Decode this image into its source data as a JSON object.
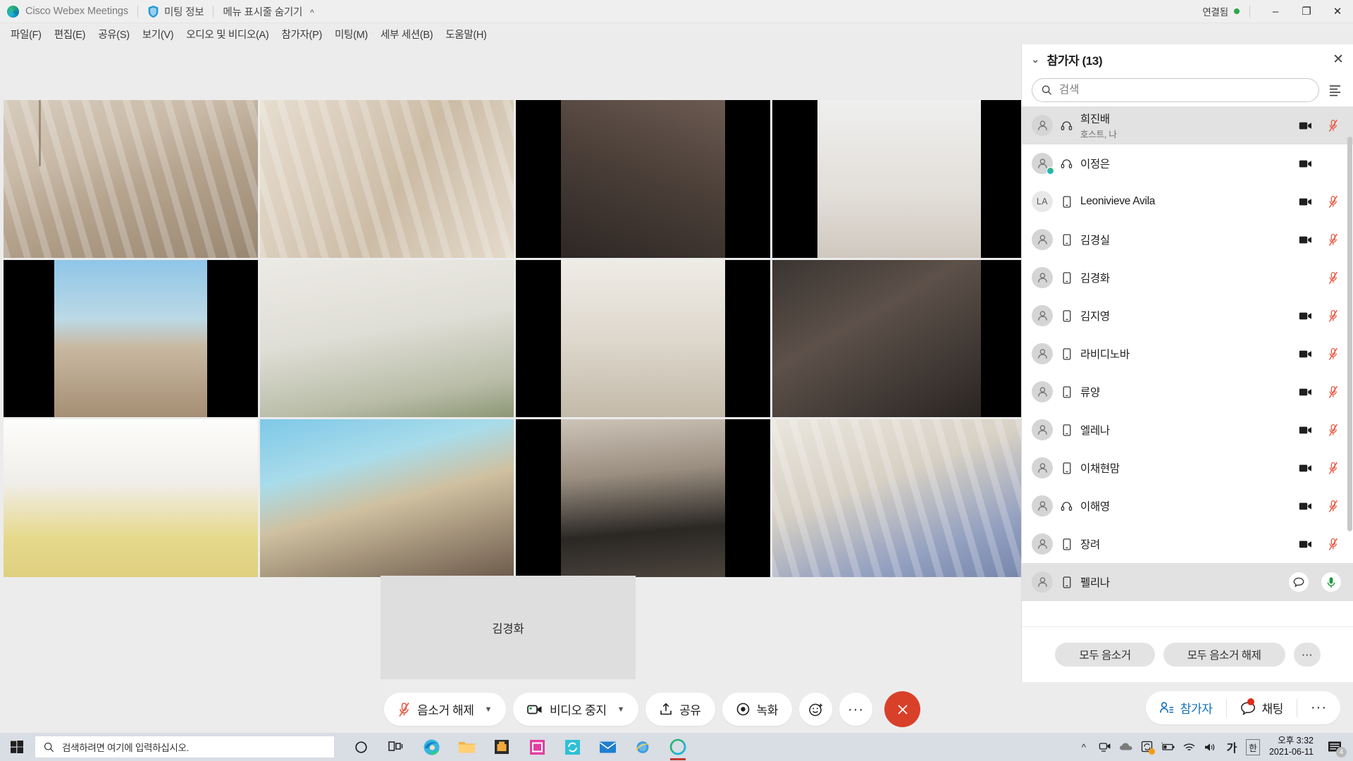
{
  "titlebar": {
    "app_name": "Cisco Webex Meetings",
    "meeting_info": "미팅 정보",
    "hide_menubar": "메뉴 표시줄 숨기기",
    "connection_status": "연결됨",
    "minimize": "–",
    "maximize": "❐",
    "close": "✕"
  },
  "menubar": {
    "items": [
      {
        "label": "파일(F)"
      },
      {
        "label": "편집(E)"
      },
      {
        "label": "공유(S)"
      },
      {
        "label": "보기(V)"
      },
      {
        "label": "오디오 및 비디오(A)"
      },
      {
        "label": "참가자(P)"
      },
      {
        "label": "미팅(M)"
      },
      {
        "label": "세부 세션(B)"
      },
      {
        "label": "도움말(H)"
      }
    ]
  },
  "stage": {
    "active_speaker_name": "김경화"
  },
  "controlbar": {
    "mute_label": "음소거 해제",
    "video_label": "비디오 중지",
    "share_label": "공유",
    "record_label": "녹화",
    "reactions_label": "리액션",
    "more_label": "···",
    "end_label": "✕",
    "participants_label": "참가자",
    "chat_label": "채팅",
    "right_more_label": "···"
  },
  "panel": {
    "title": "참가자 (13)",
    "close": "✕",
    "search_placeholder": "검색",
    "search_value": "",
    "mute_all": "모두 음소거",
    "unmute_all": "모두 음소거 해제",
    "more": "···",
    "participants": [
      {
        "name": "희진배",
        "sub": "호스트, 나",
        "avatar": "person",
        "initials": "",
        "device": "headset",
        "video": true,
        "mic": "muted",
        "selected": true,
        "presence": false
      },
      {
        "name": "이정은",
        "sub": "",
        "avatar": "person",
        "initials": "",
        "device": "headset",
        "video": true,
        "mic": "none",
        "selected": false,
        "presence": true
      },
      {
        "name": "Leonivieve Avila",
        "sub": "",
        "avatar": "initials",
        "initials": "LA",
        "device": "phone",
        "video": true,
        "mic": "muted",
        "selected": false,
        "presence": false
      },
      {
        "name": "김경실",
        "sub": "",
        "avatar": "person",
        "initials": "",
        "device": "phone",
        "video": true,
        "mic": "muted",
        "selected": false,
        "presence": false
      },
      {
        "name": "김경화",
        "sub": "",
        "avatar": "person",
        "initials": "",
        "device": "phone",
        "video": false,
        "mic": "muted",
        "selected": false,
        "presence": false
      },
      {
        "name": "김지영",
        "sub": "",
        "avatar": "person",
        "initials": "",
        "device": "phone",
        "video": true,
        "mic": "muted",
        "selected": false,
        "presence": false
      },
      {
        "name": "라비디노바",
        "sub": "",
        "avatar": "person",
        "initials": "",
        "device": "phone",
        "video": true,
        "mic": "muted",
        "selected": false,
        "presence": false
      },
      {
        "name": "류양",
        "sub": "",
        "avatar": "person",
        "initials": "",
        "device": "phone",
        "video": true,
        "mic": "muted",
        "selected": false,
        "presence": false
      },
      {
        "name": "엘레나",
        "sub": "",
        "avatar": "person",
        "initials": "",
        "device": "phone",
        "video": true,
        "mic": "muted",
        "selected": false,
        "presence": false
      },
      {
        "name": "이채현맘",
        "sub": "",
        "avatar": "person",
        "initials": "",
        "device": "phone",
        "video": true,
        "mic": "muted",
        "selected": false,
        "presence": false
      },
      {
        "name": "이해영",
        "sub": "",
        "avatar": "person",
        "initials": "",
        "device": "headset",
        "video": true,
        "mic": "muted",
        "selected": false,
        "presence": false
      },
      {
        "name": "장려",
        "sub": "",
        "avatar": "person",
        "initials": "",
        "device": "phone",
        "video": true,
        "mic": "muted",
        "selected": false,
        "presence": false
      },
      {
        "name": "펠리나",
        "sub": "",
        "avatar": "person",
        "initials": "",
        "device": "phone",
        "video": false,
        "mic": "active",
        "selected": true,
        "presence": false,
        "chat": true
      }
    ]
  },
  "taskbar": {
    "search_placeholder": "검색하려면 여기에 입력하십시오.",
    "ime_ko": "한",
    "ime_char": "가",
    "time": "오후 3:32",
    "date": "2021-06-11",
    "notification_count": "4"
  },
  "colors": {
    "accent_blue": "#1270b8",
    "mute_red": "#e8563f",
    "end_call_red": "#d9402a",
    "active_mic_green": "#1a9c3c",
    "panel_bg": "#ffffff",
    "app_bg": "#ececec"
  }
}
